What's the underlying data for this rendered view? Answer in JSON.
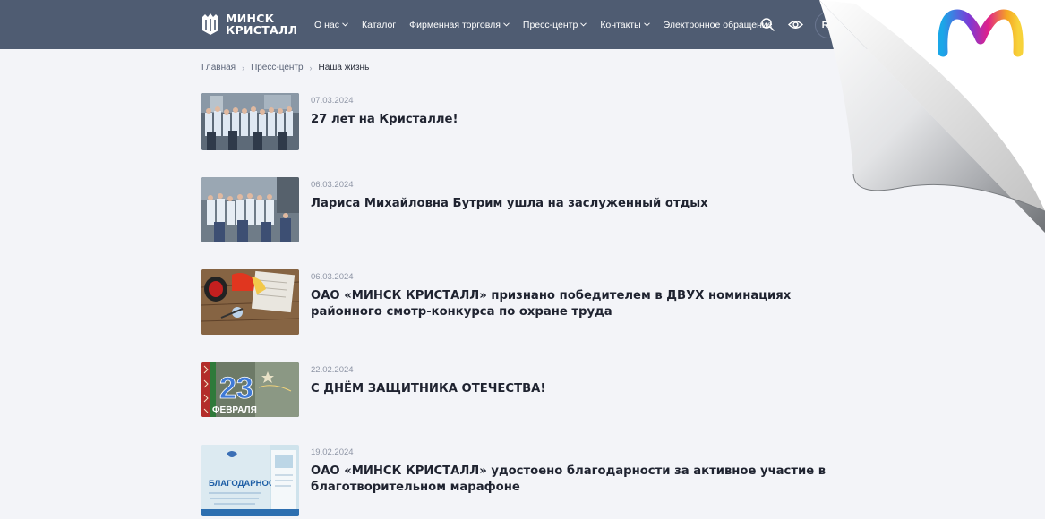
{
  "header": {
    "logo_text": "МИНСК\nКРИСТАЛЛ",
    "nav": [
      {
        "label": "О нас",
        "has_dropdown": true
      },
      {
        "label": "Каталог",
        "has_dropdown": false
      },
      {
        "label": "Фирменная торговля",
        "has_dropdown": true
      },
      {
        "label": "Пресс-центр",
        "has_dropdown": true
      },
      {
        "label": "Контакты",
        "has_dropdown": true
      },
      {
        "label": "Электронное обращение",
        "has_dropdown": false
      }
    ],
    "lang": "RU"
  },
  "breadcrumb": {
    "home": "Главная",
    "section": "Пресс-центр",
    "current": "Наша жизнь"
  },
  "news": [
    {
      "date": "07.03.2024",
      "title": "27 лет на Кристалле!"
    },
    {
      "date": "06.03.2024",
      "title": "Лариса Михайловна Бутрим ушла на заслуженный отдых"
    },
    {
      "date": "06.03.2024",
      "title": "ОАО «МИНСК КРИСТАЛЛ» признано победителем в ДВУХ номинациях районного смотр-конкурса по охране труда"
    },
    {
      "date": "22.02.2024",
      "title": "С ДНЁМ ЗАЩИТНИКА ОТЕЧЕСТВА!",
      "thumb_number": "23",
      "thumb_month": "ФЕВРАЛЯ"
    },
    {
      "date": "19.02.2024",
      "title": "ОАО «МИНСК КРИСТАЛЛ» удостоено благодарности за активное участие в благотворительном марафоне",
      "thumb_caption": "БЛАГОДАРНОСТЬ"
    }
  ],
  "colors": {
    "header_bg": "#4f5c72",
    "page_bg": "#f3f4f8",
    "text": "#1f2330",
    "date": "#8f96a6"
  }
}
